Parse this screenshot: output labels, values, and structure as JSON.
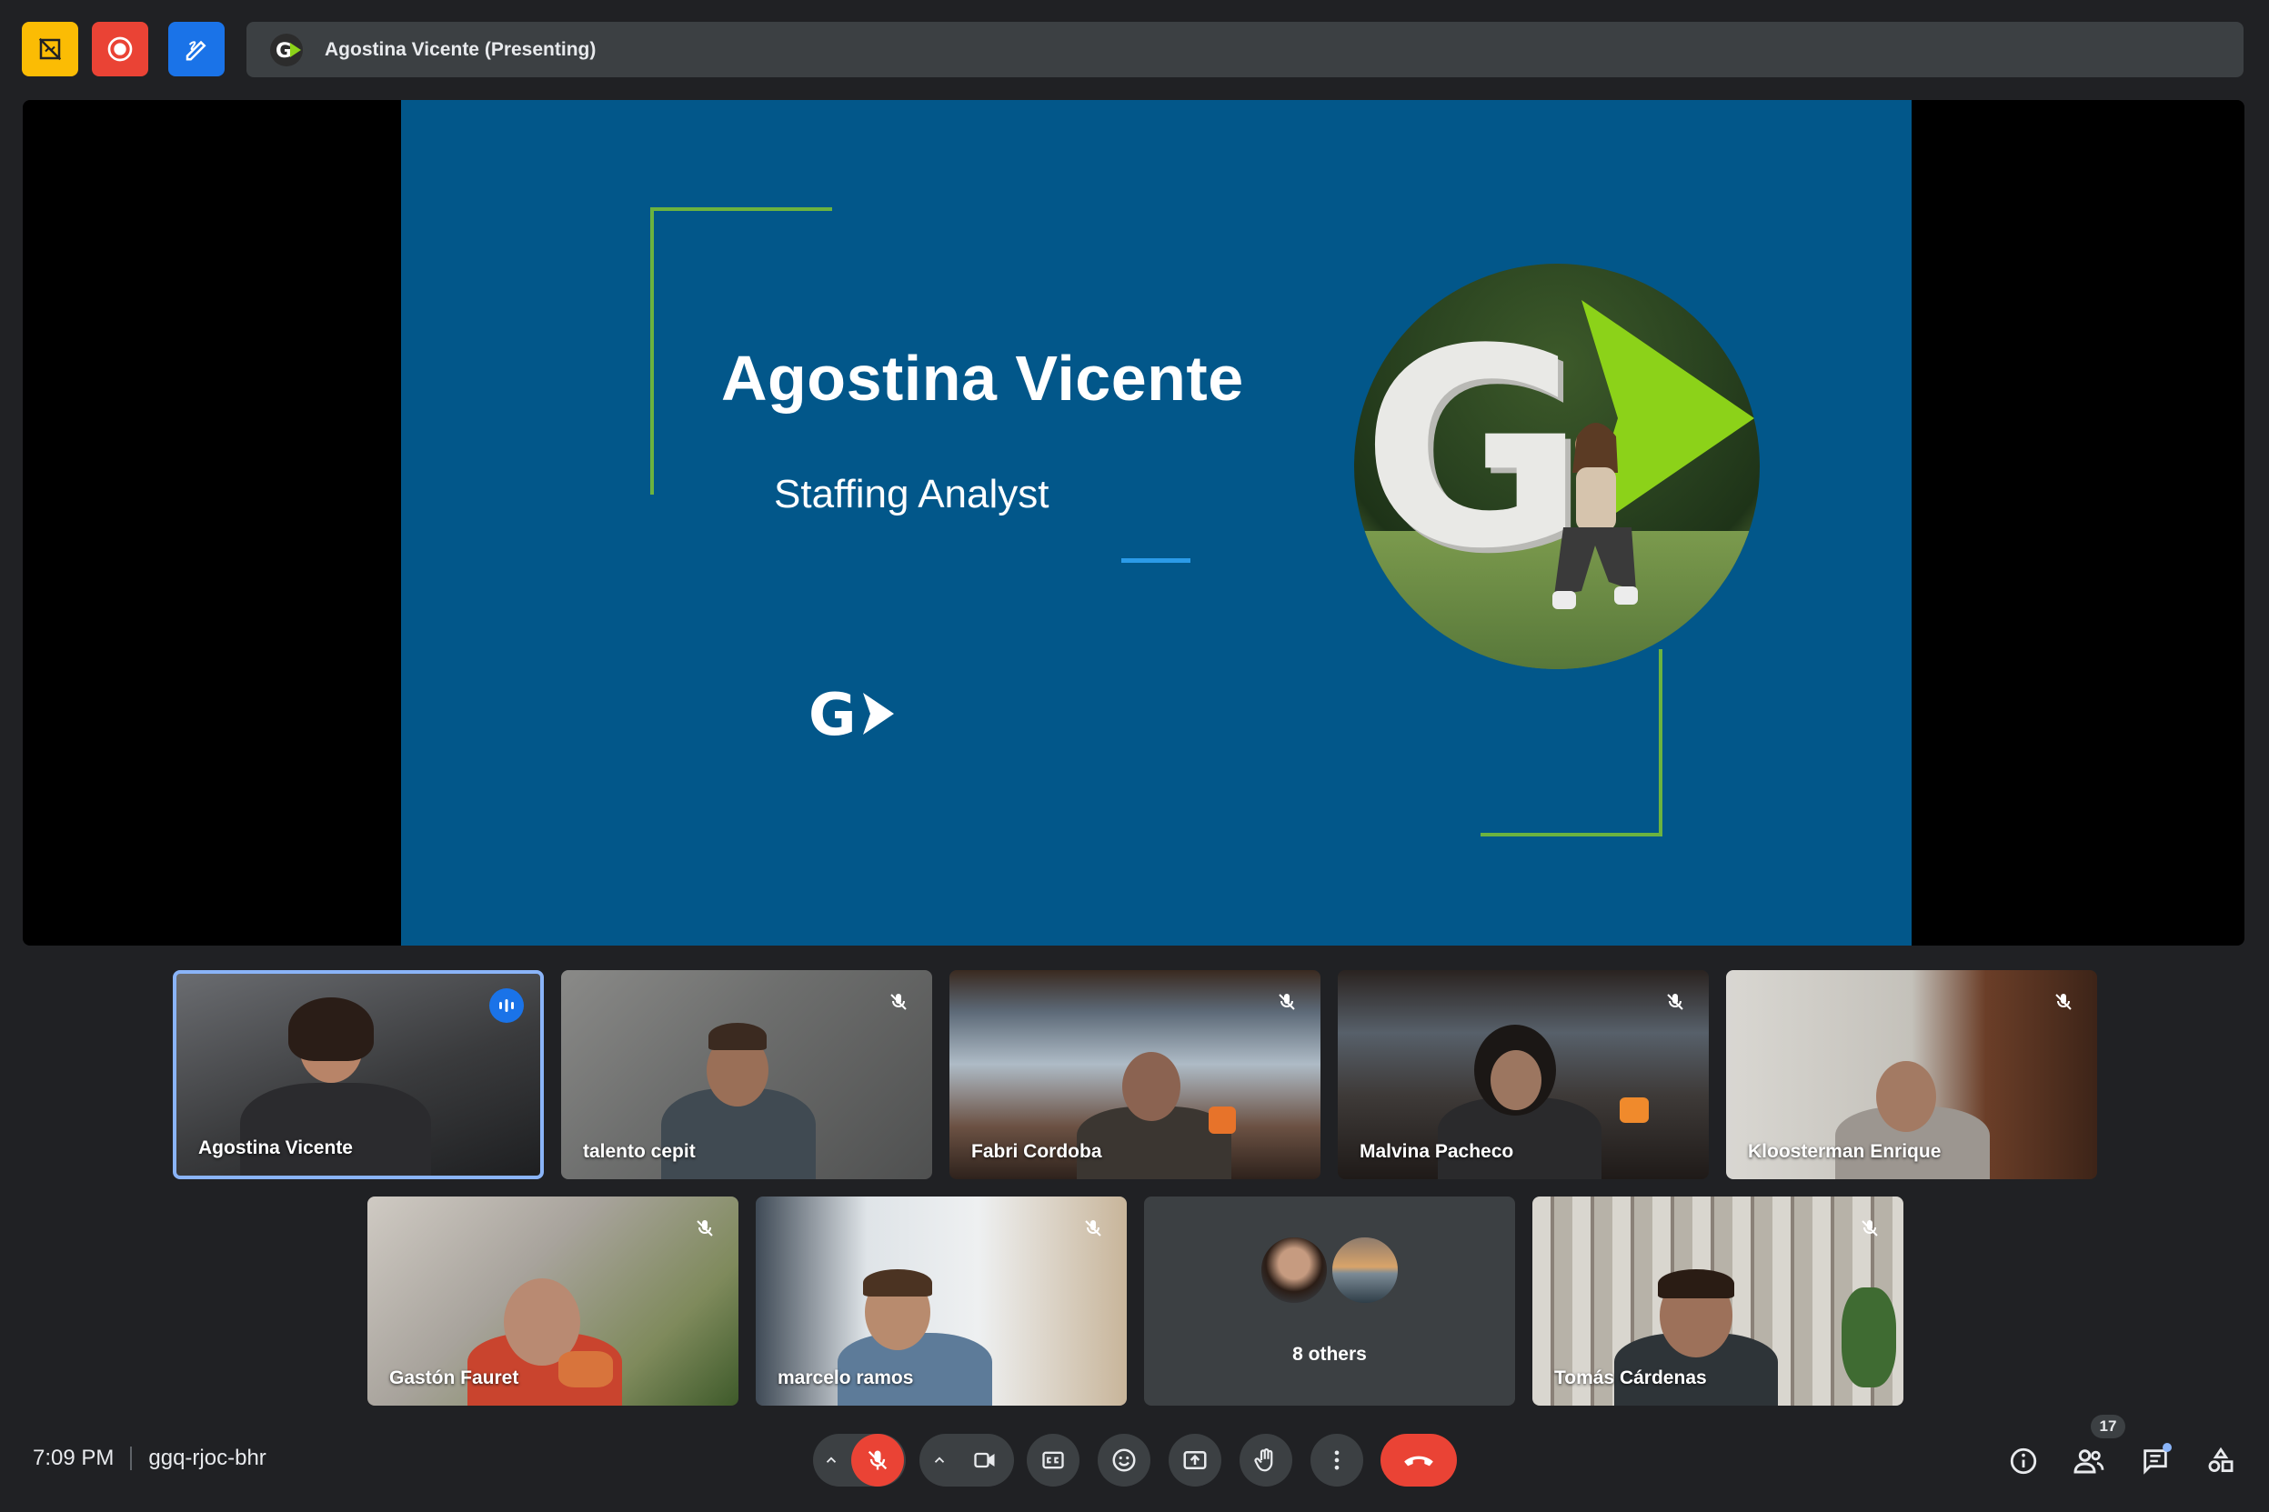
{
  "header": {
    "presenting_label": "Agostina Vicente (Presenting)",
    "icons": [
      "no-screenshots-icon",
      "recording-icon",
      "whiteboard-icon"
    ],
    "colors": {
      "yellow": "#fbbc04",
      "red": "#ea4335",
      "blue": "#1a73e8"
    }
  },
  "slide": {
    "title": "Agostina Vicente",
    "subtitle": "Staffing Analyst",
    "logo_text": "G",
    "colors": {
      "background": "#02578a",
      "accent_green": "#6cb33f",
      "accent_blue": "#2b9be8",
      "arrow_green": "#8cd219"
    }
  },
  "participants": [
    {
      "name": "Agostina Vicente",
      "speaking": true,
      "muted": false
    },
    {
      "name": "talento cepit",
      "muted": true
    },
    {
      "name": "Fabri Cordoba",
      "muted": true
    },
    {
      "name": "Malvina Pacheco",
      "muted": true
    },
    {
      "name": "Kloosterman Enrique",
      "muted": true
    },
    {
      "name": "Gastón Fauret",
      "muted": true
    },
    {
      "name": "marcelo ramos",
      "muted": true
    },
    {
      "name": "8 others",
      "muted": false
    },
    {
      "name": "Tomás Cárdenas",
      "muted": true
    }
  ],
  "footer": {
    "time": "7:09 PM",
    "meeting_code": "ggq-rjoc-bhr",
    "people_count": "17",
    "controls": [
      "mic-options",
      "mic-off",
      "camera-options",
      "camera",
      "captions",
      "emoji",
      "present",
      "raise-hand",
      "more-options",
      "leave-call"
    ],
    "right_icons": [
      "info",
      "people",
      "chat",
      "activities"
    ]
  }
}
